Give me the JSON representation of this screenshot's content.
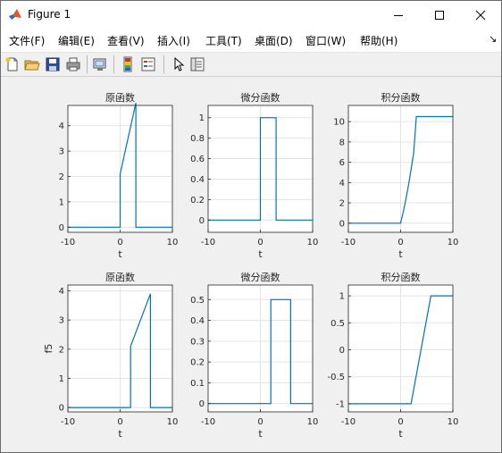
{
  "window": {
    "title": "Figure 1"
  },
  "menu": [
    "文件(F)",
    "编辑(E)",
    "查看(V)",
    "插入(I)",
    "工具(T)",
    "桌面(D)",
    "窗口(W)",
    "帮助(H)"
  ],
  "toolbar": {
    "icons": [
      "new-figure-icon",
      "open-file-icon",
      "save-icon",
      "print-icon",
      "link-plot-icon",
      "insert-colorbar-icon",
      "insert-legend-icon",
      "edit-plot-icon",
      "property-inspector-icon"
    ]
  },
  "chart_data": [
    {
      "type": "line",
      "title": "原函数",
      "xlabel": "t",
      "ylabel": "",
      "xlim": [
        -10,
        10
      ],
      "ylim": [
        -0.2,
        4.8
      ],
      "xticks": [
        "-10",
        "0",
        "10"
      ],
      "yticks": [
        "0",
        "1",
        "2",
        "3",
        "4"
      ],
      "grid": true,
      "color": "#0072bd",
      "x": [
        -10,
        0,
        0,
        3,
        3,
        10
      ],
      "y": [
        0,
        0,
        2.1,
        4.9,
        0,
        0
      ]
    },
    {
      "type": "line",
      "title": "微分函数",
      "xlabel": "t",
      "ylabel": "",
      "xlim": [
        -10,
        10
      ],
      "ylim": [
        -0.12,
        1.12
      ],
      "xticks": [
        "-10",
        "0",
        "10"
      ],
      "yticks": [
        "0",
        "0.2",
        "0.4",
        "0.6",
        "0.8",
        "1"
      ],
      "grid": true,
      "color": "#0072bd",
      "x": [
        -10,
        0,
        0,
        3,
        3,
        10
      ],
      "y": [
        0,
        0,
        1,
        1,
        0,
        0
      ]
    },
    {
      "type": "line",
      "title": "积分函数",
      "xlabel": "t",
      "ylabel": "",
      "xlim": [
        -10,
        10
      ],
      "ylim": [
        -0.9,
        11.6
      ],
      "xticks": [
        "-10",
        "0",
        "10"
      ],
      "yticks": [
        "0",
        "2",
        "4",
        "6",
        "8",
        "10"
      ],
      "grid": true,
      "color": "#0072bd",
      "x": [
        -10,
        0,
        0.5,
        1,
        1.5,
        2,
        2.5,
        3,
        10
      ],
      "y": [
        0,
        0,
        1.1,
        2.35,
        3.75,
        5.3,
        6.9,
        10.5,
        10.5
      ]
    },
    {
      "type": "line",
      "title": "原函数",
      "xlabel": "t",
      "ylabel": "f5",
      "xlim": [
        -10,
        10
      ],
      "ylim": [
        -0.15,
        4.2
      ],
      "xticks": [
        "-10",
        "0",
        "10"
      ],
      "yticks": [
        "0",
        "1",
        "2",
        "3",
        "4"
      ],
      "grid": true,
      "color": "#0072bd",
      "x": [
        -10,
        2,
        2,
        5.8,
        5.8,
        10
      ],
      "y": [
        0,
        0,
        2.1,
        3.9,
        0,
        0
      ]
    },
    {
      "type": "line",
      "title": "微分函数",
      "xlabel": "t",
      "ylabel": "",
      "xlim": [
        -10,
        10
      ],
      "ylim": [
        -0.04,
        0.57
      ],
      "xticks": [
        "-10",
        "0",
        "10"
      ],
      "yticks": [
        "0",
        "0.1",
        "0.2",
        "0.3",
        "0.4",
        "0.5"
      ],
      "grid": true,
      "color": "#0072bd",
      "x": [
        -10,
        2,
        2,
        5.8,
        5.8,
        10
      ],
      "y": [
        0,
        0,
        0.5,
        0.5,
        0,
        0
      ]
    },
    {
      "type": "line",
      "title": "积分函数",
      "xlabel": "t",
      "ylabel": "",
      "xlim": [
        -10,
        10
      ],
      "ylim": [
        -1.15,
        1.2
      ],
      "xticks": [
        "-10",
        "0",
        "10"
      ],
      "yticks": [
        "-1",
        "-0.5",
        "0",
        "0.5",
        "1"
      ],
      "grid": true,
      "color": "#0072bd",
      "x": [
        -10,
        2,
        5.8,
        10
      ],
      "y": [
        -1,
        -1,
        1,
        1
      ]
    }
  ]
}
